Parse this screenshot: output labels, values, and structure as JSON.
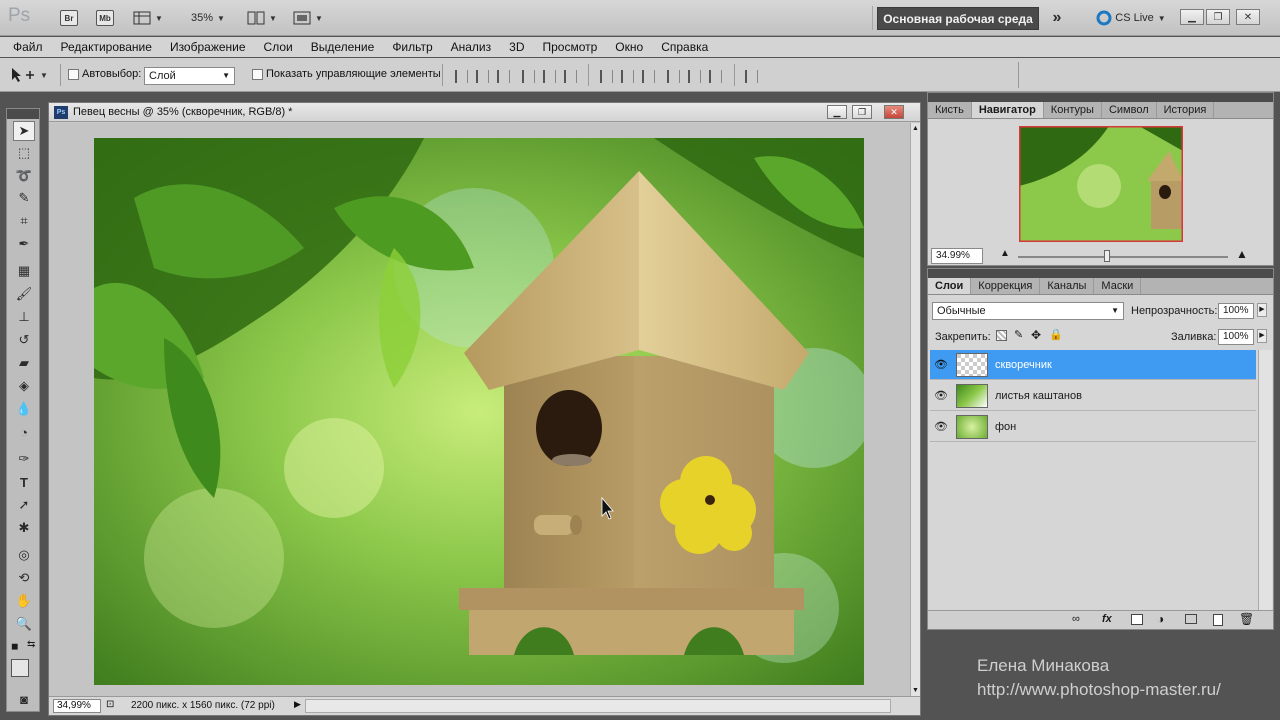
{
  "app": {
    "logo": "Ps",
    "bridge": "Br",
    "minibridge": "Mb",
    "zoom": "35%",
    "workspace": "Основная рабочая среда",
    "cs_live": "CS Live"
  },
  "menu": [
    "Файл",
    "Редактирование",
    "Изображение",
    "Слои",
    "Выделение",
    "Фильтр",
    "Анализ",
    "3D",
    "Просмотр",
    "Окно",
    "Справка"
  ],
  "options": {
    "autoselect_label": "Автовыбор:",
    "autoselect_value": "Слой",
    "show_controls_label": "Показать управляющие элементы"
  },
  "document": {
    "title": "Певец весны @ 35% (скворечник, RGB/8) *",
    "zoom_field": "34,99%",
    "status": "2200 пикс. x 1560 пикс. (72 ppi)"
  },
  "navigator": {
    "tabs": [
      "Кисть",
      "Навигатор",
      "Контуры",
      "Символ",
      "История"
    ],
    "active_tab": "Навигатор",
    "zoom": "34.99%"
  },
  "layers": {
    "tabs": [
      "Слои",
      "Коррекция",
      "Каналы",
      "Маски"
    ],
    "blend_mode": "Обычные",
    "opacity_label": "Непрозрачность:",
    "opacity": "100%",
    "lock_label": "Закрепить:",
    "fill_label": "Заливка:",
    "fill": "100%",
    "items": [
      {
        "name": "скворечник",
        "selected": true
      },
      {
        "name": "листья каштанов",
        "selected": false
      },
      {
        "name": "фон",
        "selected": false
      }
    ]
  },
  "watermark": {
    "author": "Елена Минакова",
    "url": "http://www.photoshop-master.ru/"
  },
  "colors": {
    "selection": "#3f9bf1",
    "foreground": "#e6e6e6",
    "background": "#4a9a3c"
  }
}
